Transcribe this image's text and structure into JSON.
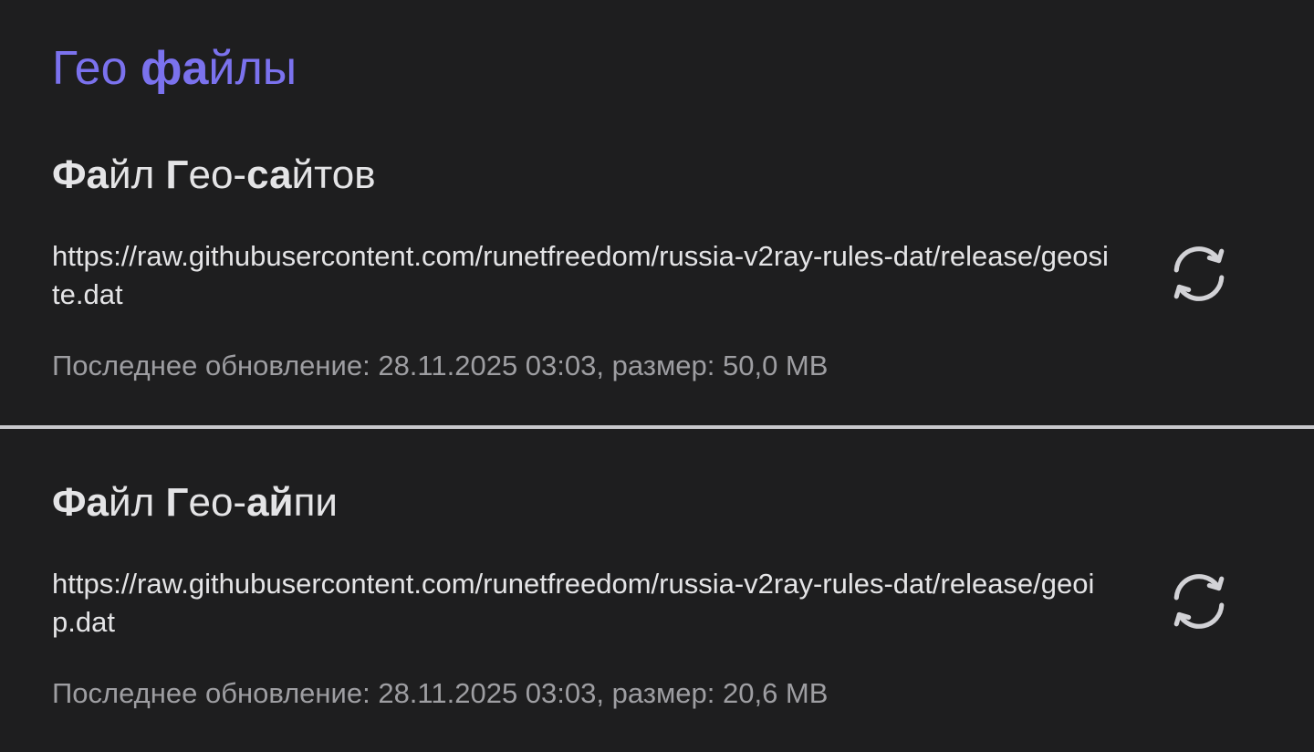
{
  "section": {
    "title_part1": "Гео ",
    "title_part2": "фа",
    "title_part3": "йлы"
  },
  "files": [
    {
      "title_a": "Фа",
      "title_b": "йл ",
      "title_c": "Г",
      "title_d": "ео-",
      "title_e": "са",
      "title_f": "йтов",
      "url_prefix": "https://raw.githubusercontent.com/runetfreedom/russia-v2ray-rules-dat/release/",
      "url_file": "geosite.dat",
      "meta_label": "Последнее обновление: ",
      "meta_date": "28.11.2025 03:03",
      "meta_size_label": ", размер: ",
      "meta_size": "50,0 MB",
      "refresh_icon": "refresh-icon"
    },
    {
      "title_a": "Фа",
      "title_b": "йл ",
      "title_c": "Г",
      "title_d": "ео-",
      "title_e": "ай",
      "title_f": "пи",
      "url_prefix": "https://raw.githubusercontent.com/runetfreedom/russia-v2ray-rules-dat/release/",
      "url_file": "geoip.dat",
      "meta_label": "Последнее обновление: ",
      "meta_date": "28.11.2025 03:03",
      "meta_size_label": ", размер: ",
      "meta_size": "20,6 MB",
      "refresh_icon": "refresh-icon"
    }
  ],
  "colors": {
    "background": "#1e1e1f",
    "accent": "#7b72ee",
    "text_primary": "#e4e4e6",
    "text_secondary": "#9e9ea2",
    "divider": "#c8c8cc",
    "icon": "#d2d2d6"
  }
}
